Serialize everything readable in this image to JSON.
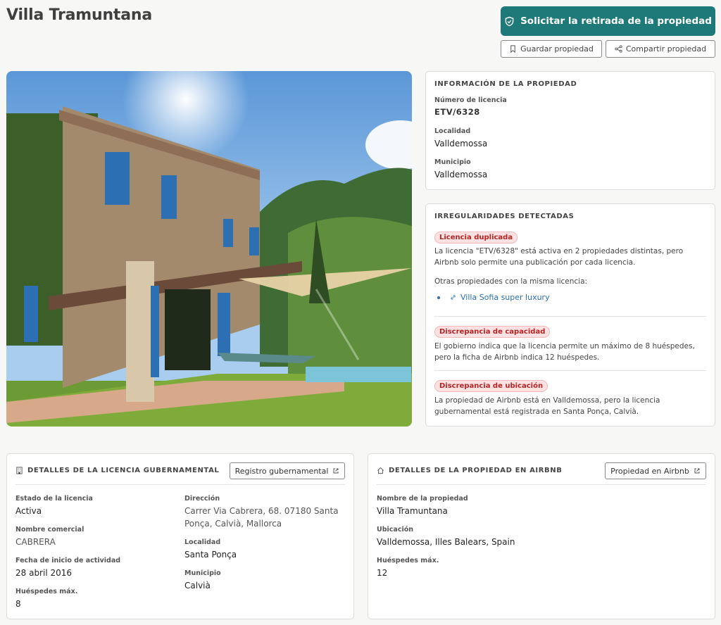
{
  "header": {
    "title": "Villa Tramuntana",
    "primary_button": "Solicitar la retirada de la propiedad",
    "save_button": "Guardar propiedad",
    "share_button": "Compartir propiedad"
  },
  "property_info": {
    "heading": "INFORMACIÓN DE LA PROPIEDAD",
    "license_label": "Número de licencia",
    "license_value": "ETV/6328",
    "locality_label": "Localidad",
    "locality_value": "Valldemossa",
    "municipality_label": "Municipio",
    "municipality_value": "Valldemossa"
  },
  "irregularities": {
    "heading": "IRREGULARIDADES DETECTADAS",
    "items": [
      {
        "tag": "Licencia duplicada",
        "text_line1": "La licencia \"ETV/6328\" está activa en 2 propiedades distintas, pero",
        "text_line2": "Airbnb solo permite una publicación por cada licencia.",
        "others_label": "Otras propiedades con la misma licencia:",
        "link": "Villa Sofia super luxury"
      },
      {
        "tag": "Discrepancia de capacidad",
        "text_line1": "El gobierno indica que la licencia permite un máximo de 8 huéspedes,",
        "text_line2": "pero la ficha de Airbnb indica 12 huéspedes."
      },
      {
        "tag": "Discrepancia de ubicación",
        "text_line1": "La propiedad de Airbnb está en Valldemossa, pero la licencia",
        "text_line2": "gubernamental está registrada en Santa Ponça, Calvià."
      }
    ]
  },
  "gov_license": {
    "heading": "DETALLES DE LA LICENCIA GUBERNAMENTAL",
    "button": "Registro gubernamental",
    "status_label": "Estado de la licencia",
    "status_value": "Activa",
    "trade_name_label": "Nombre comercial",
    "trade_name_value": "CABRERA",
    "start_date_label": "Fecha de inicio de actividad",
    "start_date_value": "28 abril 2016",
    "max_guests_label": "Huéspedes máx.",
    "max_guests_value": "8",
    "address_label": "Dirección",
    "address_line1": "Carrer Via Cabrera, 68. 07180 Santa",
    "address_line2": "Ponça, Calvià, Mallorca",
    "locality_label": "Localidad",
    "locality_value": "Santa Ponça",
    "municipality_label": "Municipio",
    "municipality_value": "Calvià"
  },
  "airbnb": {
    "heading": "DETALLES DE LA PROPIEDAD EN AIRBNB",
    "button": "Propiedad en Airbnb",
    "name_label": "Nombre de la propiedad",
    "name_value": "Villa Tramuntana",
    "location_label": "Ubicación",
    "location_value": "Valldemossa, Illes Balears, Spain",
    "max_guests_label": "Huéspedes máx.",
    "max_guests_value": "12"
  },
  "icons": {
    "primary": "shield-icon",
    "save": "bookmark-icon",
    "share": "share-icon",
    "link": "link-icon",
    "external": "external-link-icon",
    "building": "building-icon",
    "home": "home-icon"
  },
  "colors": {
    "accent": "#1e7a78",
    "tag_bg": "#fbe1e1",
    "tag_text": "#b52424",
    "link": "#2a6fb0"
  }
}
